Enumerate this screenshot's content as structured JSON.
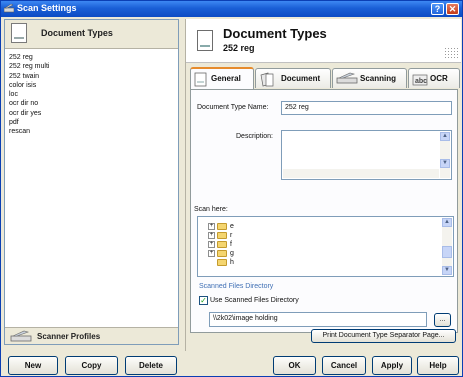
{
  "window": {
    "title": "Scan Settings",
    "help_label": "?",
    "close_label": "✕"
  },
  "left": {
    "header": "Document Types",
    "items": [
      "252 reg",
      "252 reg multi",
      "252 twain",
      "color isis",
      "loc",
      "ocr dir no",
      "ocr dir yes",
      "pdf",
      "rescan"
    ],
    "footer": "Scanner Profiles"
  },
  "buttons": {
    "new": "New",
    "copy": "Copy",
    "delete": "Delete",
    "ok": "OK",
    "cancel": "Cancel",
    "apply": "Apply",
    "help": "Help"
  },
  "right": {
    "title": "Document Types",
    "subtitle": "252 reg",
    "tabs": [
      {
        "label": "General",
        "icon": "document-icon"
      },
      {
        "label": "Document",
        "icon": "documents-icon"
      },
      {
        "label": "Scanning",
        "icon": "scanner-icon"
      },
      {
        "label": "OCR",
        "icon": "ocr-icon"
      }
    ],
    "general": {
      "name_label": "Document Type Name:",
      "name_value": "252 reg",
      "description_label": "Description:",
      "description_value": "",
      "scan_here_label": "Scan here:",
      "tree": [
        "e",
        "r",
        "f",
        "g",
        "h"
      ],
      "group_label": "Scanned Files Directory",
      "use_dir_label": "Use Scanned Files Directory",
      "use_dir_checked": true,
      "dir_value": "\\\\2k02\\image holding",
      "browse_label": "...",
      "print_label": "Print Document Type Separator Page..."
    }
  },
  "colors": {
    "title_bar": "#1a5fd6",
    "accent_tab": "#e68b2c",
    "group_title": "#3f6fb4"
  }
}
